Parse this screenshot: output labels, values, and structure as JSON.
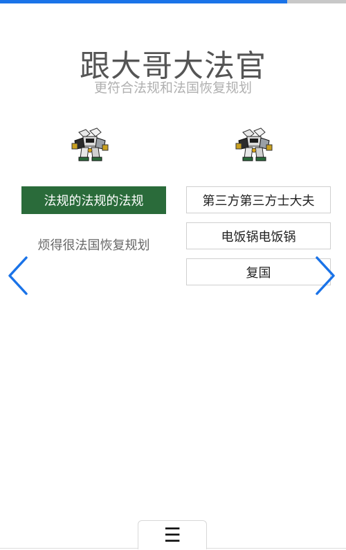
{
  "progress": {
    "percent": 83,
    "color": "#1a73e8"
  },
  "header": {
    "title": "跟大哥大法官",
    "subtitle": "更符合法规和法国恢复规划"
  },
  "left_panel": {
    "image_icon": "mech-robot-icon",
    "button_label": "法规的法规的法规",
    "caption": "烦得很法国恢复规划"
  },
  "right_panel": {
    "image_icon": "mech-robot-icon",
    "options": [
      "第三方第三方士大夫",
      "电饭锅电饭锅",
      "复国"
    ]
  },
  "navigation": {
    "prev_icon": "chevron-left-icon",
    "next_icon": "chevron-right-icon"
  },
  "footer": {
    "menu_icon": "hamburger-menu-icon",
    "menu_glyph": "☰"
  },
  "colors": {
    "accent": "#1a73e8",
    "button_green": "#2a6b3a"
  }
}
